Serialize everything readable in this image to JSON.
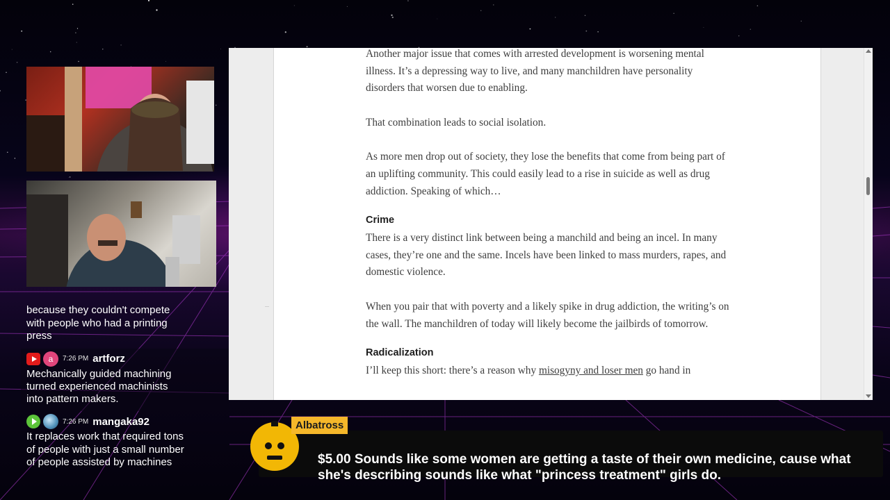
{
  "chat": {
    "fragment": "because they couldn't compete with people who had a printing press",
    "messages": [
      {
        "platform_icon": "youtube-icon",
        "avatar_letter": "a",
        "time": "7:26 PM",
        "user": "artforz",
        "text": "Mechanically guided machining turned experienced machinists into pattern makers."
      },
      {
        "platform_icon": "play-icon",
        "avatar_icon": "globe-avatar-icon",
        "time": "7:26 PM",
        "user": "mangaka92",
        "text": "It replaces work that required tons of people with just a small number of people assisted by machines"
      }
    ]
  },
  "article": {
    "p1": "Another major issue that comes with arrested development is worsening mental illness. It’s a depressing way to live, and many manchildren have personality disorders that worsen due to enabling.",
    "p2": "That combination leads to social isolation.",
    "p3": "As more men drop out of society, they lose the benefits that come from being part of an uplifting community. This could easily lead to a rise in suicide as well as drug addiction. Speaking of which…",
    "h_crime": "Crime",
    "p4": "There is a very distinct link between being a manchild and being an incel. In many cases, they’re one and the same. Incels have been linked to mass murders, rapes, and domestic violence.",
    "p5": "When you pair that with poverty and a likely spike in drug addiction, the writing’s on the wall. The manchildren of today will likely become the jailbirds of tomorrow.",
    "h_radical": "Radicalization",
    "p6_a": "I’ll keep this short: there’s a reason why ",
    "p6_link": "misogyny and loser men",
    "p6_b": " go hand in"
  },
  "alert": {
    "name": "Albatross",
    "message": "$5.00 Sounds like some women are getting a taste of their own medicine, cause what she's describing sounds like what \"princess treatment\" girls do."
  },
  "colors": {
    "alert_accent": "#f5b72a",
    "youtube_red": "#e21b1b",
    "neon_pink": "#e628c8"
  }
}
